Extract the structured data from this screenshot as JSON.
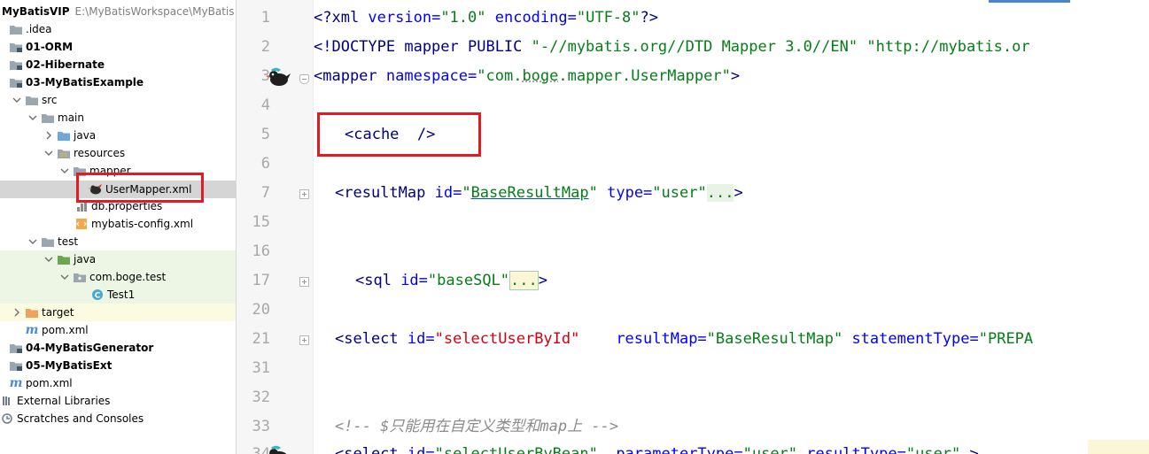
{
  "tree": {
    "root_label": "MyBatisVIP",
    "root_path": "E:\\MyBatisWorkspace\\MyBatis",
    "items": [
      {
        "label": ".idea"
      },
      {
        "label": "01-ORM"
      },
      {
        "label": "02-Hibernate"
      },
      {
        "label": "03-MyBatisExample"
      },
      {
        "label": "src"
      },
      {
        "label": "main"
      },
      {
        "label": "java"
      },
      {
        "label": "resources"
      },
      {
        "label": "mapper"
      },
      {
        "label": "UserMapper.xml"
      },
      {
        "label": "db.properties"
      },
      {
        "label": "mybatis-config.xml"
      },
      {
        "label": "test"
      },
      {
        "label": "java"
      },
      {
        "label": "com.boge.test"
      },
      {
        "label": "Test1"
      },
      {
        "label": "target"
      },
      {
        "label": "pom.xml"
      },
      {
        "label": "04-MyBatisGenerator"
      },
      {
        "label": "05-MyBatisExt"
      },
      {
        "label": "pom.xml"
      },
      {
        "label": "External Libraries"
      },
      {
        "label": "Scratches and Consoles"
      }
    ]
  },
  "editor": {
    "line_numbers": [
      "1",
      "2",
      "3",
      "4",
      "5",
      "6",
      "7",
      "15",
      "16",
      "17",
      "20",
      "21",
      "31",
      "32",
      "33",
      "34"
    ],
    "code": {
      "l1": {
        "p1": "<?xml ",
        "p2": "version=",
        "p3": "\"1.0\"",
        "p4": " encoding=",
        "p5": "\"UTF-8\"",
        "p6": "?>"
      },
      "l2": {
        "p1": "<!DOCTYPE mapper PUBLIC ",
        "p2": "\"-//mybatis.org//DTD Mapper 3.0//EN\"",
        "p3": " ",
        "p4": "\"http://mybatis.or"
      },
      "l3": {
        "p1": "<mapper ",
        "p2": "namespace=",
        "p3": "\"com.",
        "p4": "boge",
        "p5": ".mapper.UserMapper\"",
        "p6": ">"
      },
      "l5": {
        "p1": "<cache  />"
      },
      "l7": {
        "p1": "<resultMap ",
        "p2": "id=",
        "p3": "\"",
        "p4": "BaseResultMap",
        "p5": "\"",
        "p6": " type=",
        "p7": "\"user\"",
        "p8": "...",
        "p9": ">"
      },
      "l17": {
        "p1": "<sql ",
        "p2": "id=",
        "p3": "\"baseSQL\"",
        "p4": "...",
        "p5": ">"
      },
      "l21": {
        "p1": "<select ",
        "p2": "id=",
        "p3": "\"selectUserById\"",
        "p4": "    resultMap=",
        "p5": "\"BaseResultMap\"",
        "p6": " statementType=",
        "p7": "\"PREPA"
      },
      "l33": {
        "p1": "<!-- $只能用在自定义类型和map上 -->"
      },
      "l34": {
        "p1": "<select ",
        "p2": "id=",
        "p3": "\"selectUserByBean\"",
        "p4": "  parameterType=",
        "p5": "\"user\"",
        "p6": " resultType=",
        "p7": "\"user\"",
        "p8": " >"
      }
    }
  },
  "colors": {
    "tag": "#000080",
    "attr": "#0000ff",
    "value": "#067d17",
    "red_value": "#d4000f",
    "comment": "#8c8c8c",
    "annotation_box": "#e11b22"
  },
  "icons": {
    "module": "module-folder-icon",
    "folder": "folder-icon",
    "mybatis": "mybatis-bird-icon",
    "maven": "maven-m-icon"
  }
}
